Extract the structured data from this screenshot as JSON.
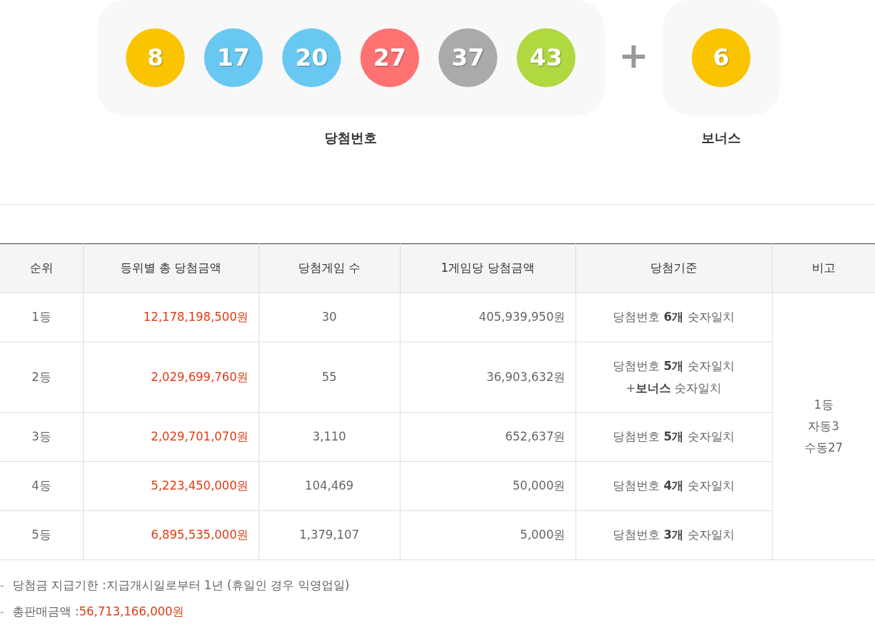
{
  "winning_numbers": {
    "label": "당첨번호",
    "balls": [
      {
        "number": "8",
        "color": "#fbc400"
      },
      {
        "number": "17",
        "color": "#69c8f2"
      },
      {
        "number": "20",
        "color": "#69c8f2"
      },
      {
        "number": "27",
        "color": "#ff7272"
      },
      {
        "number": "37",
        "color": "#aaaaaa"
      },
      {
        "number": "43",
        "color": "#b0d840"
      }
    ]
  },
  "plus": "+",
  "bonus": {
    "label": "보너스",
    "balls": [
      {
        "number": "6",
        "color": "#fbc400"
      }
    ]
  },
  "table": {
    "columns": [
      "순위",
      "등위별 총 당첨금액",
      "당첨게임 수",
      "1게임당 당첨금액",
      "당첨기준",
      "비고"
    ],
    "rows": [
      {
        "rank": "1등",
        "total": "12,178,198,500원",
        "games": "30",
        "per_game": "405,939,950원",
        "criteria": [
          "당첨번호 **6개** 숫자일치"
        ]
      },
      {
        "rank": "2등",
        "total": "2,029,699,760원",
        "games": "55",
        "per_game": "36,903,632원",
        "criteria": [
          "당첨번호 **5개** 숫자일치",
          "+**보너스** 숫자일치"
        ]
      },
      {
        "rank": "3등",
        "total": "2,029,701,070원",
        "games": "3,110",
        "per_game": "652,637원",
        "criteria": [
          "당첨번호 **5개** 숫자일치"
        ]
      },
      {
        "rank": "4등",
        "total": "5,223,450,000원",
        "games": "104,469",
        "per_game": "50,000원",
        "criteria": [
          "당첨번호 **4개** 숫자일치"
        ]
      },
      {
        "rank": "5등",
        "total": "6,895,535,000원",
        "games": "1,379,107",
        "per_game": "5,000원",
        "criteria": [
          "당첨번호 **3개** 숫자일치"
        ]
      }
    ],
    "note": [
      "1등",
      "자동3",
      "수동27"
    ]
  },
  "footnotes": [
    {
      "bullet": "-",
      "label": "당첨금 지급기한 : ",
      "value": "지급개시일로부터 1년 (휴일인 경우 익영업일)",
      "kind": "plain"
    },
    {
      "bullet": "-",
      "label": "총판매금액 : ",
      "value": "56,713,166,000원",
      "kind": "amount"
    }
  ]
}
